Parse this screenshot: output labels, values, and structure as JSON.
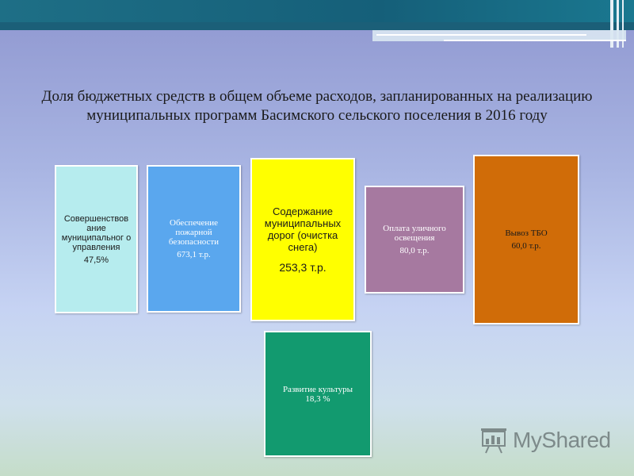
{
  "title": "Доля бюджетных средств в общем объеме расходов, запланированных на реализацию муниципальных программ Басимского сельского поселения в 2016 году",
  "boxes": [
    {
      "label": "Совершенствов ание муниципальног о управления",
      "value": "47,5%",
      "color": "#b6ecee",
      "text_color": "#1a1a1a"
    },
    {
      "label": "Обеспечение пожарной безопасности",
      "value": "673,1 т.р.",
      "color": "#5aa7ee",
      "text_color": "#ffffff"
    },
    {
      "label": "Содержание муниципальных дорог (очистка снега)",
      "value": "253,3 т.р.",
      "color": "#ffff00",
      "text_color": "#1a1a1a"
    },
    {
      "label": "Оплата уличного освещения",
      "value": "80,0  т.р.",
      "color": "#a679a0",
      "text_color": "#ffffff"
    },
    {
      "label": "Вывоз ТБО",
      "value": "60,0 т.р.",
      "color": "#d06c08",
      "text_color": "#1a1a1a"
    },
    {
      "label": "Развитие культуры",
      "value": "18,3 %",
      "color": "#129a6f",
      "text_color": "#ffffff"
    }
  ],
  "logo": {
    "text": "MyShared",
    "icon": "presentation-board-icon"
  }
}
